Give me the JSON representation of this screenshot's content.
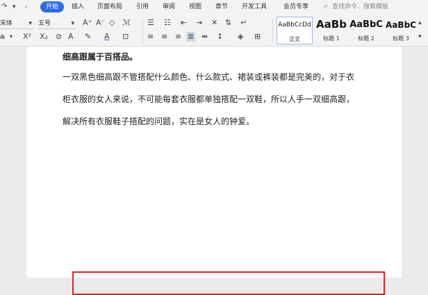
{
  "menu": {
    "items": [
      "插入",
      "页面布局",
      "引用",
      "审阅",
      "视图",
      "章节",
      "开发工具",
      "会员专享"
    ],
    "active": "开始",
    "search": "查找命令、搜索模板"
  },
  "toolbar": {
    "font_name": "宋体",
    "font_size": "五号",
    "styles": [
      {
        "sample": "AaBbCcDd",
        "name": "正文"
      },
      {
        "sample": "AaBb",
        "name": "标题 1"
      },
      {
        "sample": "AaBbC",
        "name": "标题 2"
      },
      {
        "sample": "AaBbC",
        "name": "标题 3"
      }
    ]
  },
  "document": {
    "heading": "细高跟属于百搭品。",
    "lines": [
      "一双黑色细高跟不管搭配什么颜色、什么款式、裙装或裤装都是完美的，对于衣",
      "柜衣服的女人来说，不可能每套衣服都单独搭配一双鞋，所以人手一双细高跟，",
      "解决所有衣服鞋子搭配的问题，实在是女人的钟爱。"
    ]
  },
  "colors": {
    "accent": "#2b6de6",
    "highlight_border": "#e02020"
  }
}
